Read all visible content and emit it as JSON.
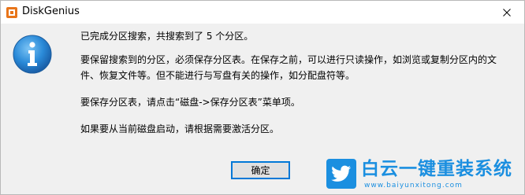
{
  "window": {
    "title": "DiskGenius",
    "app_icon": "diskgenius-icon",
    "close_icon": "close-icon"
  },
  "dialog": {
    "icon": "info-icon",
    "messages": [
      "已完成分区搜索，共搜索到了 5 个分区。",
      "要保留搜索到的分区，必须保存分区表。在保存之前，可以进行只读操作，如浏览或复制分区内的文件、恢复文件等。但不能进行与写盘有关的操作，如分配盘符等。",
      "要保存分区表，请点击“磁盘->保存分区表”菜单项。",
      "如果要从当前磁盘启动，请根据需要激活分区。"
    ],
    "ok_label": "确定"
  },
  "watermark": {
    "logo_icon": "twitter-bird-icon",
    "title": "白云一键重装系统",
    "url": "www.baiyunxitong.com"
  },
  "colors": {
    "accent": "#0078d7",
    "watermark": "#1b8fe0",
    "info_icon": "#2a8ad8"
  }
}
